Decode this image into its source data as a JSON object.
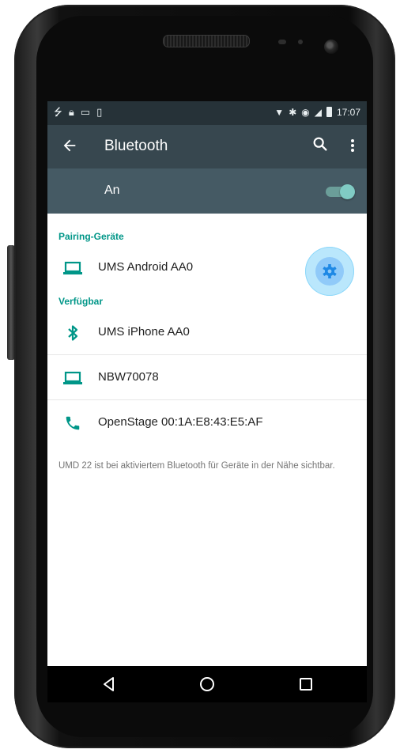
{
  "status_bar": {
    "time": "17:07"
  },
  "toolbar": {
    "title": "Bluetooth",
    "back_icon": "arrow-back-icon",
    "search_icon": "search-icon",
    "menu_icon": "more-vert-icon"
  },
  "master_switch": {
    "label": "An",
    "state": "on"
  },
  "paired": {
    "heading": "Pairing-Geräte",
    "devices": [
      {
        "name": "UMS Android AA0",
        "icon": "laptop-icon",
        "settings_icon": "gear-icon"
      }
    ]
  },
  "available": {
    "heading": "Verfügbar",
    "devices": [
      {
        "name": "UMS iPhone AA0",
        "icon": "bluetooth-icon"
      },
      {
        "name": "NBW70078",
        "icon": "laptop-icon"
      },
      {
        "name": "OpenStage 00:1A:E8:43:E5:AF",
        "icon": "phone-icon"
      }
    ]
  },
  "footer": {
    "note": "UMD 22 ist bei aktiviertem Bluetooth für Geräte in der Nähe sichtbar."
  },
  "colors": {
    "status_bar": "#263238",
    "toolbar": "#37474f",
    "switch_bar": "#455a64",
    "accent": "#009688",
    "toggle_thumb": "#80cbc4"
  }
}
